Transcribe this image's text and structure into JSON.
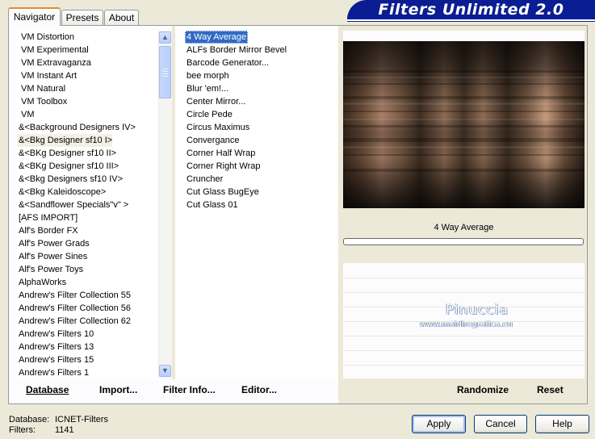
{
  "banner": {
    "title": "Filters Unlimited 2.0"
  },
  "tabs": [
    {
      "label": "Navigator",
      "active": true
    },
    {
      "label": "Presets",
      "active": false
    },
    {
      "label": "About",
      "active": false
    }
  ],
  "categories": {
    "items": [
      "VM Distortion",
      "VM Experimental",
      "VM Extravaganza",
      "VM Instant Art",
      "VM Natural",
      "VM Toolbox",
      "VM",
      "&<Background Designers IV>",
      "&<Bkg Designer sf10 I>",
      "&<BKg Designer sf10 II>",
      "&<BKg Designer sf10 III>",
      "&<Bkg Designers sf10 IV>",
      "&<Bkg Kaleidoscope>",
      "&<Sandflower Specials\"v\" >",
      "[AFS IMPORT]",
      "Alf's Border FX",
      "Alf's Power Grads",
      "Alf's Power Sines",
      "Alf's Power Toys",
      "AlphaWorks",
      "Andrew's Filter Collection 55",
      "Andrew's Filter Collection 56",
      "Andrew's Filter Collection 62",
      "Andrew's Filters 10",
      "Andrew's Filters 13",
      "Andrew's Filters 15",
      "Andrew's Filters 1"
    ],
    "selected_index": 8
  },
  "filters": {
    "items": [
      "4 Way Average",
      "ALFs Border Mirror Bevel",
      "Barcode Generator...",
      "bee morph",
      "Blur 'em!...",
      "Center Mirror...",
      "Circle Pede",
      "Circus Maximus",
      "Convergance",
      "Corner Half Wrap",
      "Corner Right Wrap",
      "Cruncher",
      "Cut Glass  BugEye",
      "Cut Glass 01"
    ],
    "selected_index": 0
  },
  "preview": {
    "filter_name": "4 Way Average",
    "progress": 0
  },
  "watermark": {
    "line1": "Pinuccia",
    "line2": "www.maidiregrafica.eu"
  },
  "commands": {
    "database": "Database",
    "import": "Import...",
    "filter_info": "Filter Info...",
    "editor": "Editor...",
    "randomize": "Randomize",
    "reset": "Reset"
  },
  "status": {
    "database_label": "Database:",
    "database_value": "ICNET-Filters",
    "filters_label": "Filters:",
    "filters_value": "1141"
  },
  "buttons": {
    "apply": "Apply",
    "cancel": "Cancel",
    "help": "Help"
  },
  "colors": {
    "banner": "#0a1d92",
    "selection": "#316ac5",
    "tab_accent": "#e68b2c"
  }
}
